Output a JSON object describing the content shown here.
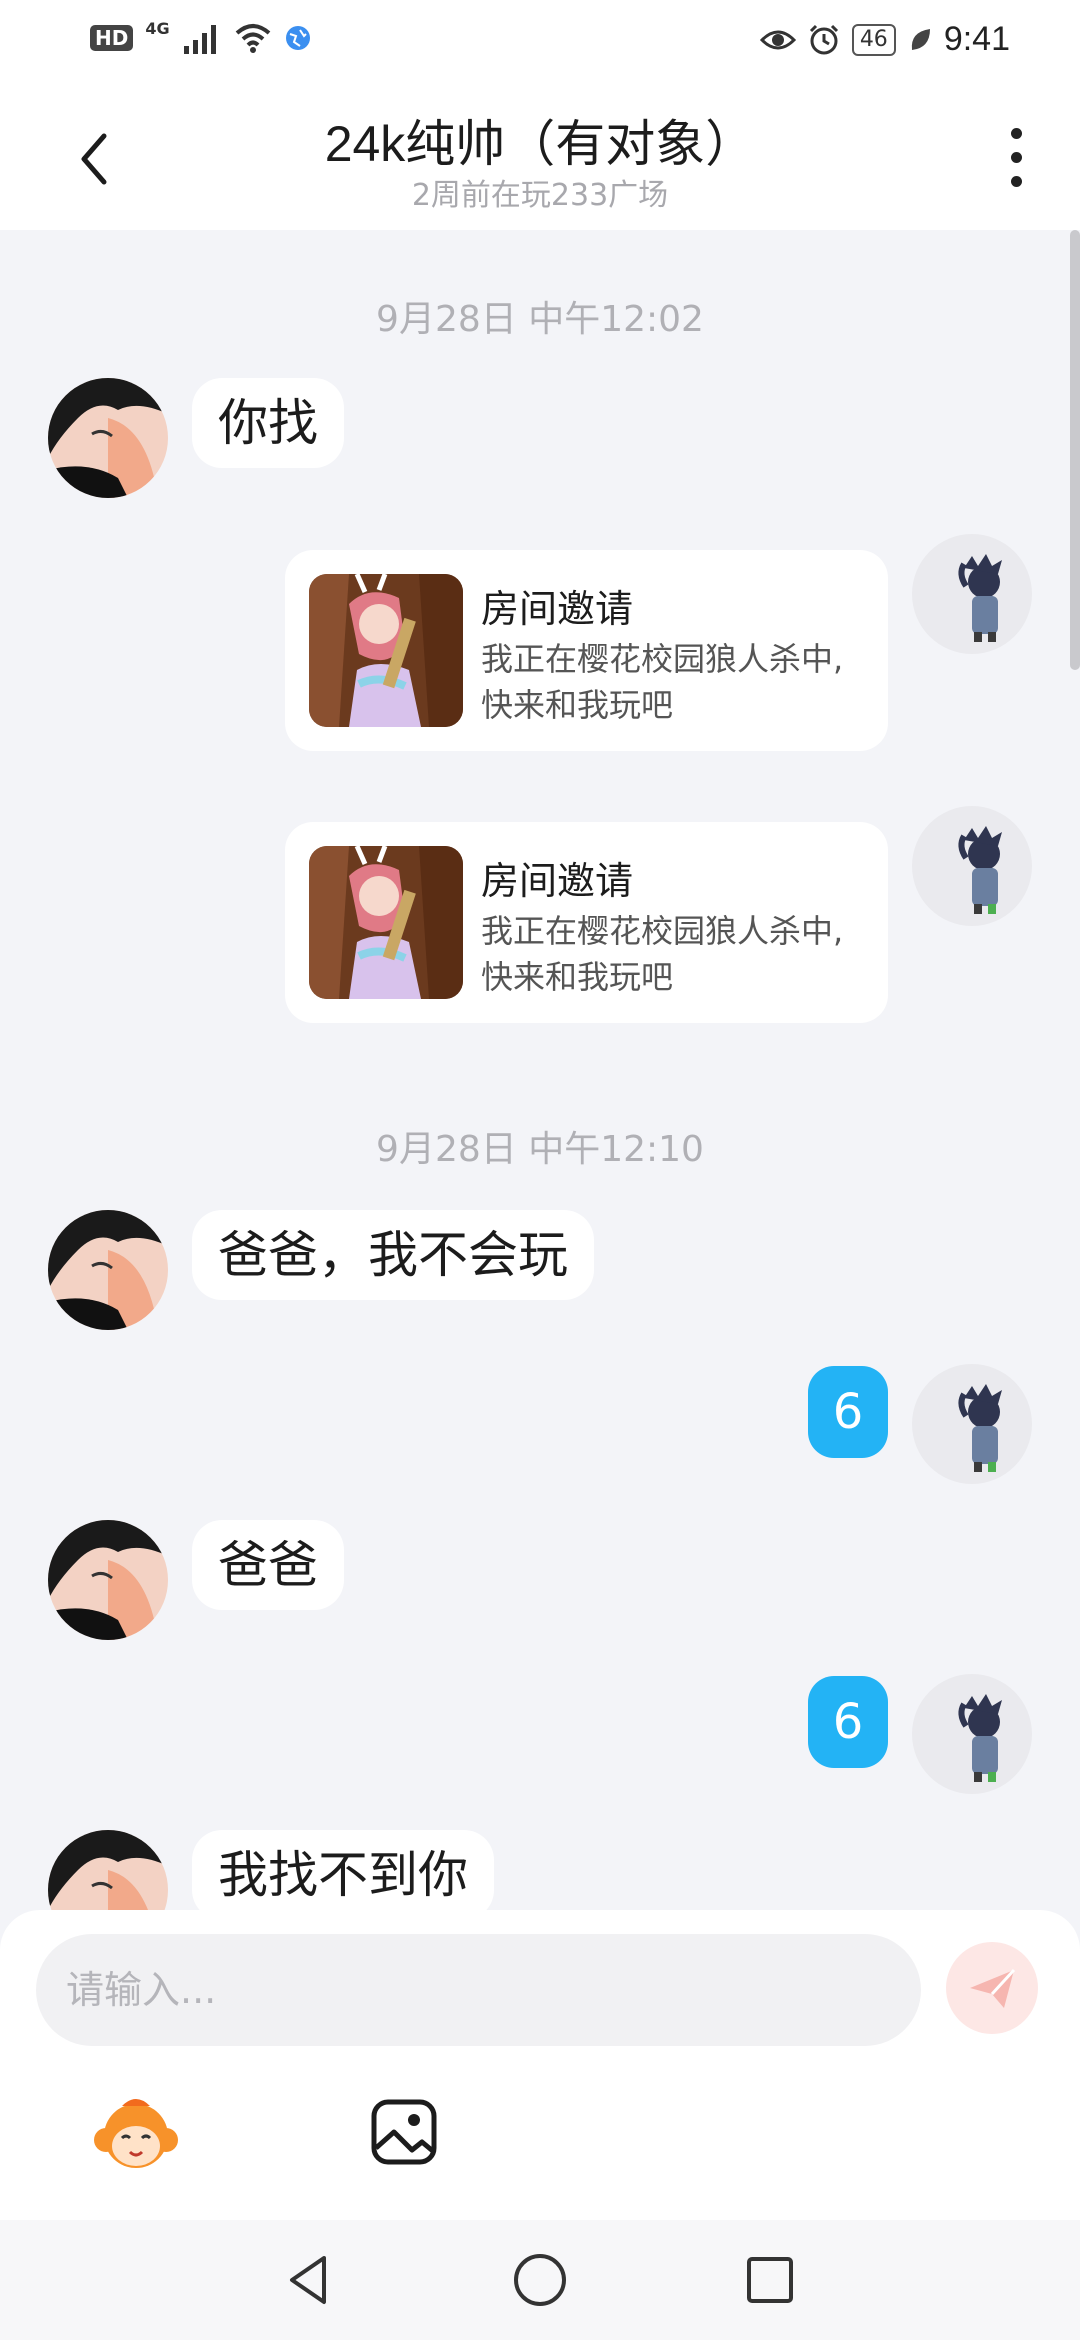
{
  "status_bar": {
    "network_badge": "HD",
    "network_type": "4G",
    "battery": "46",
    "time": "9:41",
    "icons": [
      "hd-badge",
      "signal-icon",
      "wifi-icon",
      "globe-icon",
      "eye-icon",
      "alarm-icon",
      "battery-icon",
      "leaf-icon"
    ]
  },
  "header": {
    "title": "24k纯帅（有对象）",
    "subtitle": "2周前在玩233广场"
  },
  "messages": [
    {
      "type": "timestamp",
      "text": "9月28日 中午12:02"
    },
    {
      "type": "text",
      "side": "left",
      "text": "你找"
    },
    {
      "type": "invite",
      "side": "right",
      "title": "房间邀请",
      "desc": "我正在樱花校园狼人杀中, 快来和我玩吧"
    },
    {
      "type": "invite",
      "side": "right",
      "title": "房间邀请",
      "desc": "我正在樱花校园狼人杀中, 快来和我玩吧"
    },
    {
      "type": "timestamp",
      "text": "9月28日 中午12:10"
    },
    {
      "type": "text",
      "side": "left",
      "text": "爸爸，我不会玩"
    },
    {
      "type": "text",
      "side": "right",
      "text": "6"
    },
    {
      "type": "text",
      "side": "left",
      "text": "爸爸"
    },
    {
      "type": "text",
      "side": "right",
      "text": "6"
    },
    {
      "type": "text",
      "side": "left",
      "text": "我找不到你"
    }
  ],
  "input": {
    "placeholder": "请输入..."
  },
  "colors": {
    "background": "#f3f4f8",
    "my_bubble": "#23b3f5",
    "their_bubble": "#ffffff",
    "send_button": "#fde7e5"
  }
}
